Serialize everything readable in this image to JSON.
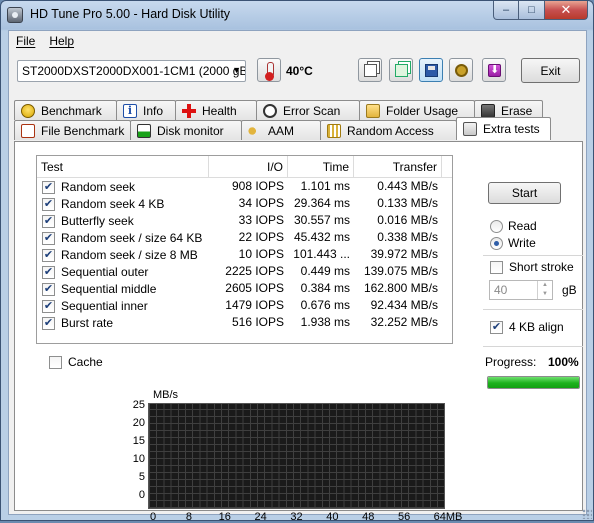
{
  "window": {
    "title": "HD Tune Pro 5.00 - Hard Disk Utility",
    "min": "–",
    "max": "□",
    "close": "✕"
  },
  "menu": {
    "file": "File",
    "help": "Help"
  },
  "toolbar": {
    "drive": "ST2000DXST2000DX001-1CM1 (2000 gB",
    "temperature": "40°C",
    "exit_label": "Exit"
  },
  "tabs_row1": [
    "Benchmark",
    "Info",
    "Health",
    "Error Scan",
    "Folder Usage",
    "Erase"
  ],
  "tabs_row2": [
    "File Benchmark",
    "Disk monitor",
    "AAM",
    "Random Access",
    "Extra tests"
  ],
  "table": {
    "headers": {
      "test": "Test",
      "io": "I/O",
      "time": "Time",
      "transfer": "Transfer"
    },
    "rows": [
      {
        "checked": true,
        "test": "Random seek",
        "io": "908 IOPS",
        "time": "1.101 ms",
        "transfer": "0.443 MB/s"
      },
      {
        "checked": true,
        "test": "Random seek 4 KB",
        "io": "34 IOPS",
        "time": "29.364 ms",
        "transfer": "0.133 MB/s"
      },
      {
        "checked": true,
        "test": "Butterfly seek",
        "io": "33 IOPS",
        "time": "30.557 ms",
        "transfer": "0.016 MB/s"
      },
      {
        "checked": true,
        "test": "Random seek / size 64 KB",
        "io": "22 IOPS",
        "time": "45.432 ms",
        "transfer": "0.338 MB/s"
      },
      {
        "checked": true,
        "test": "Random seek / size 8 MB",
        "io": "10 IOPS",
        "time": "101.443 ...",
        "transfer": "39.972 MB/s"
      },
      {
        "checked": true,
        "test": "Sequential outer",
        "io": "2225 IOPS",
        "time": "0.449 ms",
        "transfer": "139.075 MB/s"
      },
      {
        "checked": true,
        "test": "Sequential middle",
        "io": "2605 IOPS",
        "time": "0.384 ms",
        "transfer": "162.800 MB/s"
      },
      {
        "checked": true,
        "test": "Sequential inner",
        "io": "1479 IOPS",
        "time": "0.676 ms",
        "transfer": "92.434 MB/s"
      },
      {
        "checked": true,
        "test": "Burst rate",
        "io": "516 IOPS",
        "time": "1.938 ms",
        "transfer": "32.252 MB/s"
      }
    ]
  },
  "cache_label": "Cache",
  "graph": {
    "y_unit": "MB/s",
    "y_ticks": [
      "25",
      "20",
      "15",
      "10",
      "5",
      "0"
    ],
    "x_ticks": [
      "0",
      "8",
      "16",
      "24",
      "32",
      "40",
      "48",
      "56",
      "64MB"
    ]
  },
  "controls": {
    "start": "Start",
    "read": "Read",
    "write": "Write",
    "short_stroke": "Short stroke",
    "stroke_value": "40",
    "gb_unit": "gB",
    "align_4kb": "4 KB align",
    "progress_label": "Progress:",
    "progress_value": "100%",
    "progress_fraction": 1.0
  }
}
